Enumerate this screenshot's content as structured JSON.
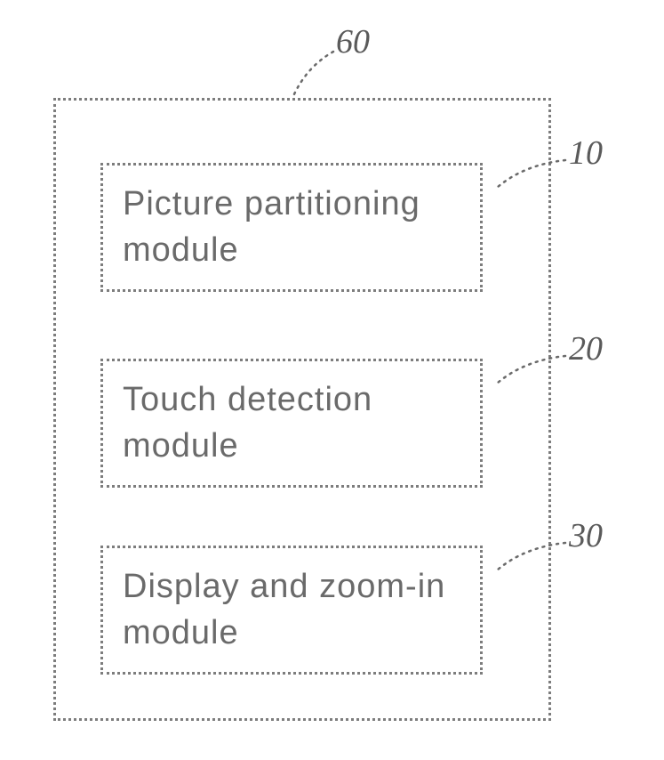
{
  "diagram": {
    "outer_ref": "60",
    "modules": [
      {
        "ref": "10",
        "label": "Picture partitioning module"
      },
      {
        "ref": "20",
        "label": "Touch detection module"
      },
      {
        "ref": "30",
        "label": "Display and zoom-in module"
      }
    ]
  }
}
